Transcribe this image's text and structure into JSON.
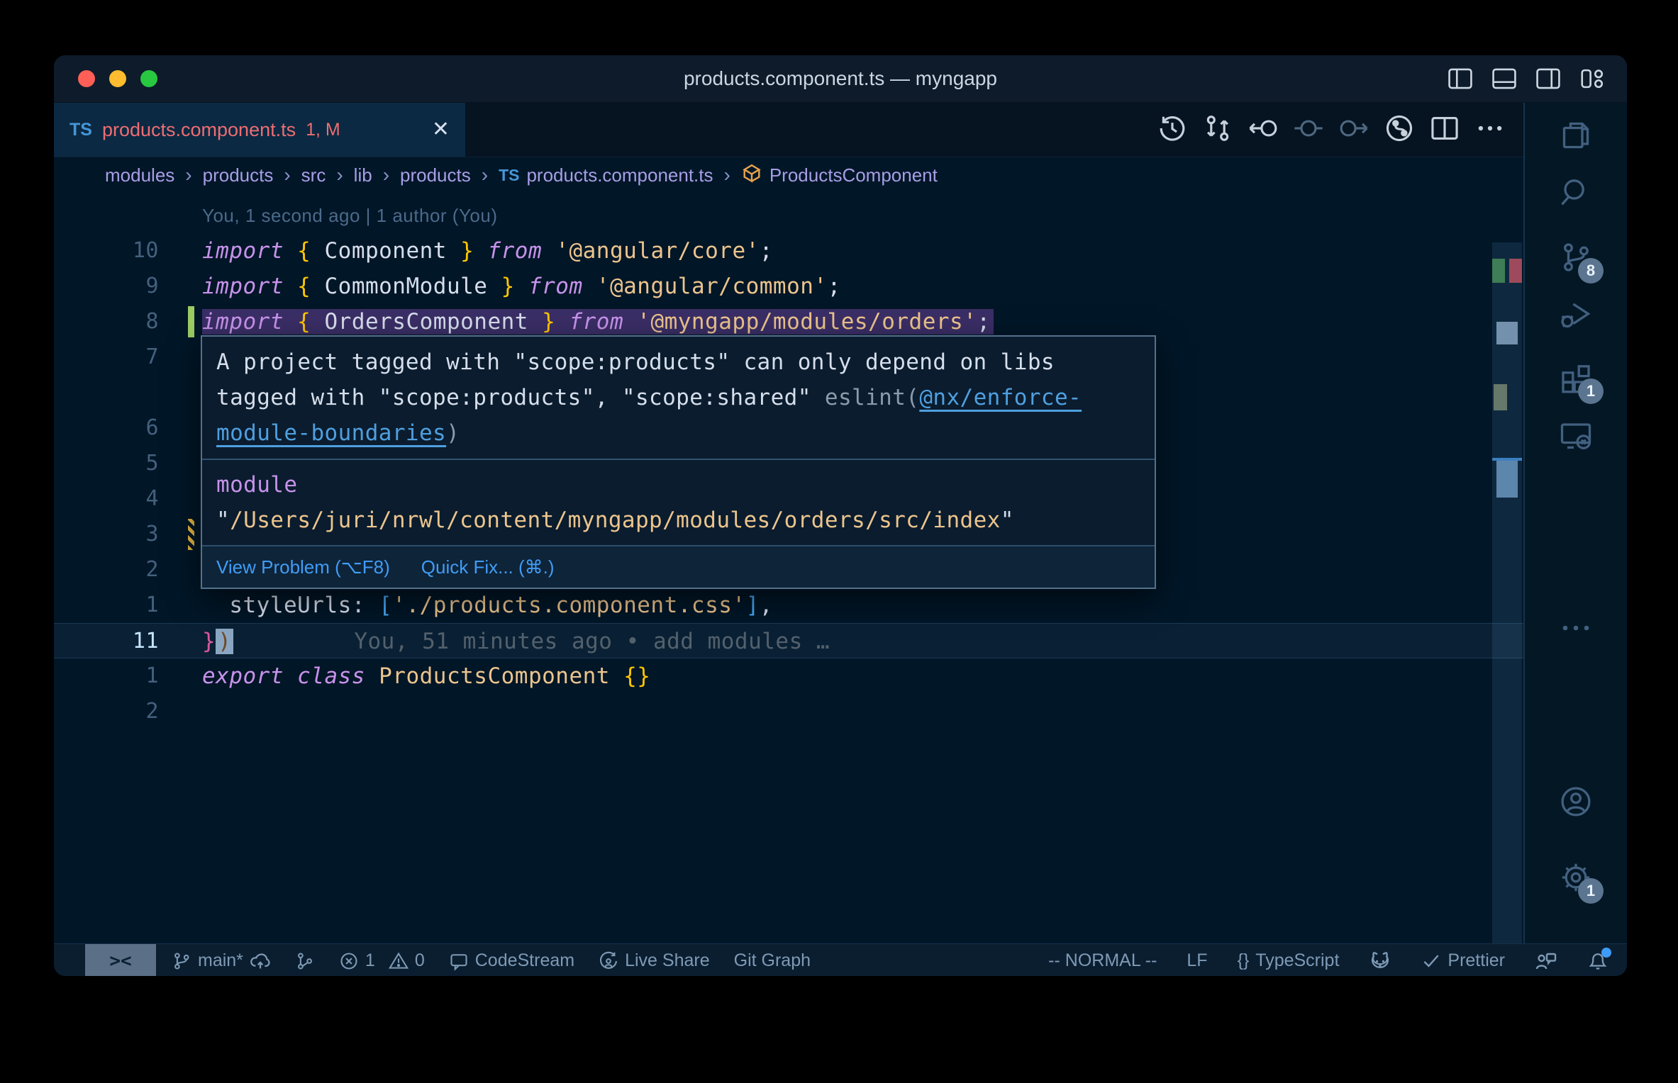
{
  "colors": {
    "editor_background": "#011627",
    "tab_active_background": "#0b2942",
    "error_red": "#ee6d72",
    "keyword_purple": "#c792ea",
    "string_orange": "#ecc48d",
    "brace_gold": "#ffc600",
    "bracket_blue": "#45a9f9",
    "added_green": "#9ccc65",
    "modified_yellow": "#e2b341",
    "squiggle_green": "#2ee52e",
    "selection_purple": "#3a2e66",
    "link_blue": "#4f9fdf",
    "action_blue": "#419cf5",
    "notification_dot_blue": "#3f9bf8"
  },
  "window": {
    "title": "products.component.ts — myngapp"
  },
  "tab": {
    "badge": "TS",
    "label": "products.component.ts",
    "decoration": "1, M"
  },
  "breadcrumbs": {
    "items": [
      "modules",
      "products",
      "src",
      "lib",
      "products"
    ],
    "file_badge": "TS",
    "file": "products.component.ts",
    "symbol": "ProductsComponent"
  },
  "editor": {
    "blame_heading": "You, 1 second ago | 1 author (You)",
    "inline_blame": "You, 51 minutes ago • add modules …",
    "rows": [
      {
        "blame_heading": true
      },
      {
        "num": "10",
        "tokens": [
          {
            "c": "kw",
            "t": "import"
          },
          {
            "c": "pun",
            "t": " "
          },
          {
            "c": "gold",
            "t": "{"
          },
          {
            "c": "id",
            "t": " Component "
          },
          {
            "c": "gold",
            "t": "}"
          },
          {
            "c": "pun",
            "t": " "
          },
          {
            "c": "kw",
            "t": "from"
          },
          {
            "c": "pun",
            "t": " "
          },
          {
            "c": "str",
            "t": "'@angular/core'"
          },
          {
            "c": "pun",
            "t": ";"
          }
        ]
      },
      {
        "num": "9",
        "tokens": [
          {
            "c": "kw",
            "t": "import"
          },
          {
            "c": "pun",
            "t": " "
          },
          {
            "c": "gold",
            "t": "{"
          },
          {
            "c": "id",
            "t": " CommonModule "
          },
          {
            "c": "gold",
            "t": "}"
          },
          {
            "c": "pun",
            "t": " "
          },
          {
            "c": "kw",
            "t": "from"
          },
          {
            "c": "pun",
            "t": " "
          },
          {
            "c": "str",
            "t": "'@angular/common'"
          },
          {
            "c": "pun",
            "t": ";"
          }
        ]
      },
      {
        "num": "8",
        "selected": true,
        "gutter": "added",
        "tokens": [
          {
            "c": "kw",
            "t": "import"
          },
          {
            "c": "pun",
            "t": " "
          },
          {
            "c": "gold",
            "t": "{"
          },
          {
            "c": "id",
            "t": " OrdersComponent "
          },
          {
            "c": "gold",
            "t": "}"
          },
          {
            "c": "pun",
            "t": " "
          },
          {
            "c": "kw",
            "t": "from"
          },
          {
            "c": "pun",
            "t": " "
          },
          {
            "c": "str",
            "t": "'@myngapp/modules/orders'"
          },
          {
            "c": "pun",
            "t": ";"
          }
        ]
      },
      {
        "num": "7",
        "tokens": []
      },
      {
        "spacer": true
      },
      {
        "num": "6",
        "tokens": []
      },
      {
        "num": "5",
        "tokens": []
      },
      {
        "num": "4",
        "tokens": []
      },
      {
        "num": "3",
        "gutter": "modified",
        "tokens": []
      },
      {
        "num": "2",
        "tokens": []
      },
      {
        "num": "1",
        "tokens": [
          {
            "c": "id",
            "t": "  styleUrls"
          },
          {
            "c": "pun",
            "t": ": "
          },
          {
            "c": "blu",
            "t": "["
          },
          {
            "c": "str",
            "t": "'./products.component.css'"
          },
          {
            "c": "blu",
            "t": "]"
          },
          {
            "c": "pun",
            "t": ","
          }
        ]
      },
      {
        "num": "11",
        "current": true,
        "inline_blame": true,
        "tokens": [
          {
            "c": "pink",
            "t": "}"
          },
          {
            "c": "cur",
            "t": ")"
          }
        ]
      },
      {
        "num": "1",
        "tokens": [
          {
            "c": "kw",
            "t": "export"
          },
          {
            "c": "pun",
            "t": " "
          },
          {
            "c": "kw",
            "t": "class"
          },
          {
            "c": "pun",
            "t": " "
          },
          {
            "c": "str",
            "t": "ProductsComponent"
          },
          {
            "c": "pun",
            "t": " "
          },
          {
            "c": "gold",
            "t": "{}"
          }
        ]
      },
      {
        "num": "2",
        "tokens": []
      }
    ]
  },
  "tooltip": {
    "message_lines": [
      [
        {
          "c": "fg",
          "t": "A project tagged with \"scope:products\" can only depend on libs"
        }
      ],
      [
        {
          "c": "fg",
          "t": "tagged with \"scope:products\", \"scope:shared\" "
        },
        {
          "c": "dim",
          "t": "eslint("
        },
        {
          "c": "link",
          "t": "@nx/enforce-"
        }
      ],
      [
        {
          "c": "link",
          "t": "module-boundaries"
        },
        {
          "c": "dim",
          "t": ")"
        }
      ]
    ],
    "module_keyword": "module",
    "module_path": "/Users/juri/nrwl/content/myngapp/modules/orders/src/index",
    "actions": [
      "View Problem (⌥F8)",
      "Quick Fix... (⌘.)"
    ]
  },
  "statusbar": {
    "branch": "main*",
    "errors": "1",
    "warnings": "0",
    "codestream": "CodeStream",
    "liveshare": "Live Share",
    "gitgraph": "Git Graph",
    "mode": "-- NORMAL --",
    "eol": "LF",
    "braces": "{}",
    "language": "TypeScript",
    "prettier": "Prettier"
  },
  "activitybar": {
    "scm_badge": "8",
    "extensions_badge": "1",
    "settings_badge": "1"
  }
}
